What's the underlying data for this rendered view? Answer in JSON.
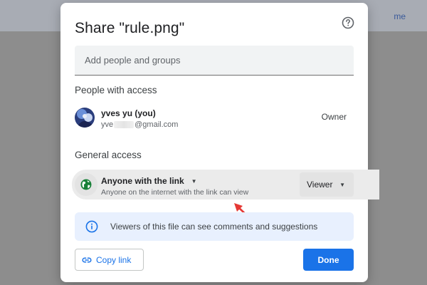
{
  "background": {
    "header_text": "me"
  },
  "dialog": {
    "title": "Share \"rule.png\"",
    "help_icon": "help-circle-icon",
    "add_people": {
      "placeholder": "Add people and groups",
      "value": ""
    },
    "people_section": {
      "label": "People with access",
      "users": [
        {
          "name": "yves yu (you)",
          "email_prefix": "yve",
          "email_suffix": "@gmail.com",
          "role": "Owner"
        }
      ]
    },
    "general_access": {
      "label": "General access",
      "icon": "globe-icon",
      "setting": "Anyone with the link",
      "description": "Anyone on the internet with the link can view",
      "role": "Viewer"
    },
    "info_banner": {
      "icon": "info-icon",
      "text": "Viewers of this file can see comments and suggestions"
    },
    "actions": {
      "copy_link": "Copy link",
      "done": "Done"
    }
  },
  "colors": {
    "accent": "#1a73e8",
    "annotation_arrow": "#e53935",
    "globe_green": "#188038"
  }
}
